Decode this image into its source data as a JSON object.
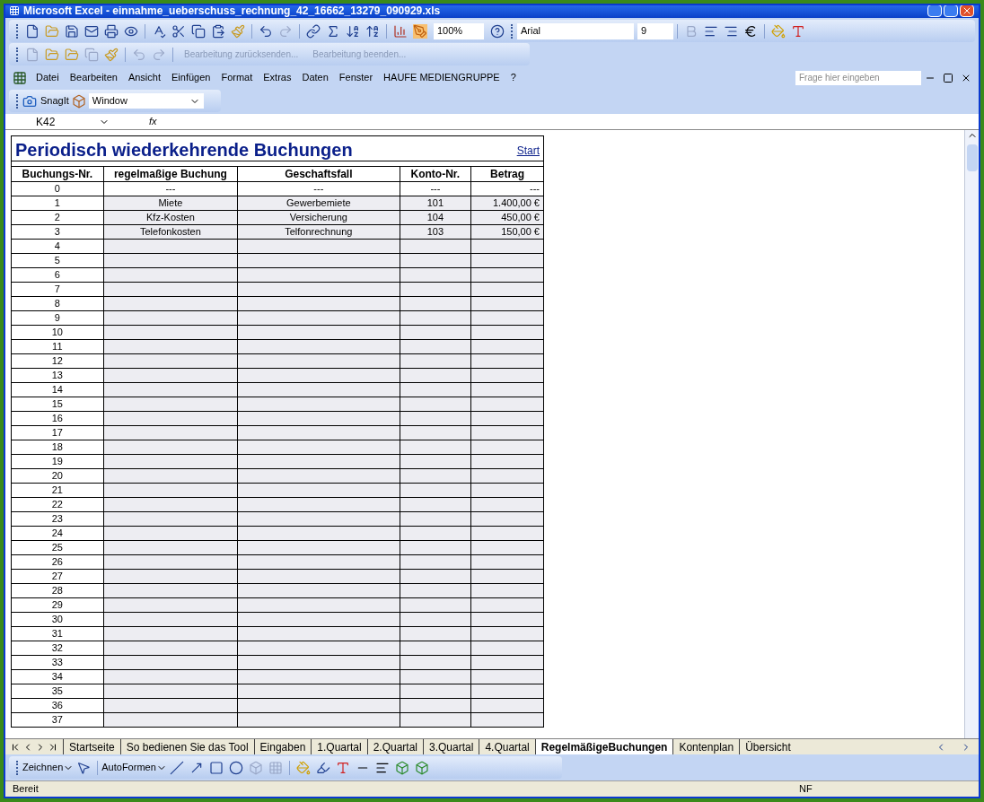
{
  "window": {
    "title": "Microsoft Excel - einnahme_ueberschuss_rechnung_42_16662_13279_090929.xls"
  },
  "standard_toolbar": {
    "zoom": "100%",
    "font": "Arial",
    "font_size": "9"
  },
  "review_toolbar": {
    "items": [
      "Bearbeitung zurücksenden...",
      "Bearbeitung beenden..."
    ]
  },
  "menu": {
    "items": [
      "Datei",
      "Bearbeiten",
      "Ansicht",
      "Einfügen",
      "Format",
      "Extras",
      "Daten",
      "Fenster",
      "HAUFE MEDIENGRUPPE",
      "?"
    ],
    "help": {
      "placeholder": "Frage hier eingeben"
    }
  },
  "snagit_toolbar": {
    "button": "SnagIt",
    "dropdown": "Window"
  },
  "formula_bar": {
    "name_box": "K42",
    "function_icon": "fx"
  },
  "sheet": {
    "title": "Periodisch wiederkehrende Buchungen",
    "link": "Start",
    "columns": [
      "Buchungs-Nr.",
      "regelmaßige Buchung",
      "Geschaftsfall",
      "Konto-Nr.",
      "Betrag"
    ],
    "rows": [
      {
        "cells": [
          "0",
          "---",
          "---",
          "---",
          "---"
        ]
      },
      {
        "cells": [
          "1",
          "Miete",
          "Gewerbemiete",
          "101",
          "1.400,00 €"
        ]
      },
      {
        "cells": [
          "2",
          "Kfz-Kosten",
          "Versicherung",
          "104",
          "450,00 €"
        ]
      },
      {
        "cells": [
          "3",
          "Telefonkosten",
          "Telfonrechnung",
          "103",
          "150,00 €"
        ]
      },
      {
        "cells": [
          "4"
        ]
      },
      {
        "cells": [
          "5"
        ]
      },
      {
        "cells": [
          "6"
        ]
      },
      {
        "cells": [
          "7"
        ]
      },
      {
        "cells": [
          "8"
        ]
      },
      {
        "cells": [
          "9"
        ]
      },
      {
        "cells": [
          "10"
        ]
      },
      {
        "cells": [
          "11"
        ]
      },
      {
        "cells": [
          "12"
        ]
      },
      {
        "cells": [
          "13"
        ]
      },
      {
        "cells": [
          "14"
        ]
      },
      {
        "cells": [
          "15"
        ]
      },
      {
        "cells": [
          "16"
        ]
      },
      {
        "cells": [
          "17"
        ]
      },
      {
        "cells": [
          "18"
        ]
      },
      {
        "cells": [
          "19"
        ]
      },
      {
        "cells": [
          "20"
        ]
      },
      {
        "cells": [
          "21"
        ]
      },
      {
        "cells": [
          "22"
        ]
      },
      {
        "cells": [
          "23"
        ]
      },
      {
        "cells": [
          "24"
        ]
      },
      {
        "cells": [
          "25"
        ]
      },
      {
        "cells": [
          "26"
        ]
      },
      {
        "cells": [
          "27"
        ]
      },
      {
        "cells": [
          "28"
        ]
      },
      {
        "cells": [
          "29"
        ]
      },
      {
        "cells": [
          "30"
        ]
      },
      {
        "cells": [
          "31"
        ]
      },
      {
        "cells": [
          "32"
        ]
      },
      {
        "cells": [
          "33"
        ]
      },
      {
        "cells": [
          "34"
        ]
      },
      {
        "cells": [
          "35"
        ]
      },
      {
        "cells": [
          "36"
        ]
      },
      {
        "cells": [
          "37"
        ]
      }
    ]
  },
  "sheet_tabs": [
    {
      "label": "Startseite",
      "selected": false
    },
    {
      "label": "So bedienen Sie das Tool",
      "selected": false
    },
    {
      "label": "Eingaben",
      "selected": false
    },
    {
      "label": "1.Quartal",
      "selected": false
    },
    {
      "label": "2.Quartal",
      "selected": false
    },
    {
      "label": "3.Quartal",
      "selected": false
    },
    {
      "label": "4.Quartal",
      "selected": false
    },
    {
      "label": "RegelmäßigeBuchungen",
      "selected": true
    },
    {
      "label": "Kontenplan",
      "selected": false
    },
    {
      "label": "Übersicht",
      "selected": false
    }
  ],
  "drawing_toolbar": {
    "draw": "Zeichnen",
    "autoshapes": "AutoFormen"
  },
  "status_bar": {
    "text": "Bereit",
    "mode": "NF"
  }
}
